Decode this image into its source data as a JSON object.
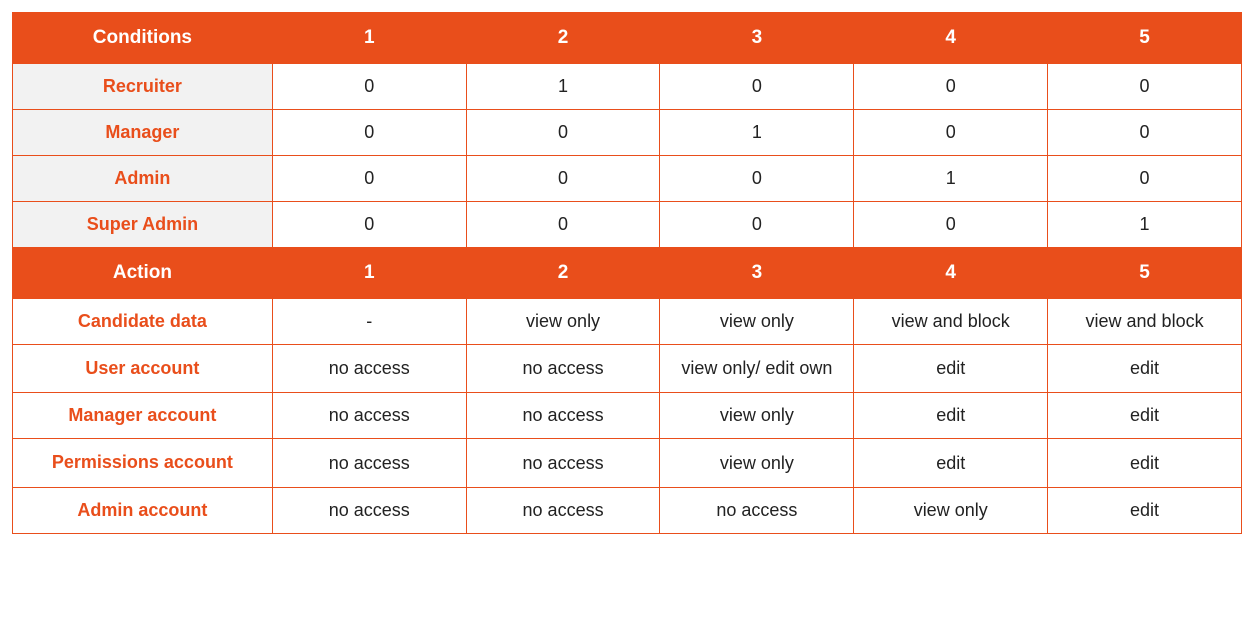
{
  "chart_data": {
    "type": "table",
    "sections": [
      {
        "header": {
          "label": "Conditions",
          "columns": [
            "1",
            "2",
            "3",
            "4",
            "5"
          ]
        },
        "rows": [
          {
            "label": "Recruiter",
            "values": [
              "0",
              "1",
              "0",
              "0",
              "0"
            ]
          },
          {
            "label": "Manager",
            "values": [
              "0",
              "0",
              "1",
              "0",
              "0"
            ]
          },
          {
            "label": "Admin",
            "values": [
              "0",
              "0",
              "0",
              "1",
              "0"
            ]
          },
          {
            "label": "Super Admin",
            "values": [
              "0",
              "0",
              "0",
              "0",
              "1"
            ]
          }
        ]
      },
      {
        "header": {
          "label": "Action",
          "columns": [
            "1",
            "2",
            "3",
            "4",
            "5"
          ]
        },
        "rows": [
          {
            "label": "Candidate data",
            "values": [
              "-",
              "view only",
              "view only",
              "view and block",
              "view and block"
            ]
          },
          {
            "label": "User account",
            "values": [
              "no access",
              "no access",
              "view only/ edit own",
              "edit",
              "edit"
            ]
          },
          {
            "label": "Manager account",
            "values": [
              "no access",
              "no access",
              "view only",
              "edit",
              "edit"
            ]
          },
          {
            "label": "Permissions account",
            "values": [
              "no access",
              "no access",
              "view only",
              "edit",
              "edit"
            ]
          },
          {
            "label": "Admin account",
            "values": [
              "no access",
              "no access",
              "no access",
              "view only",
              "edit"
            ]
          }
        ]
      }
    ]
  }
}
